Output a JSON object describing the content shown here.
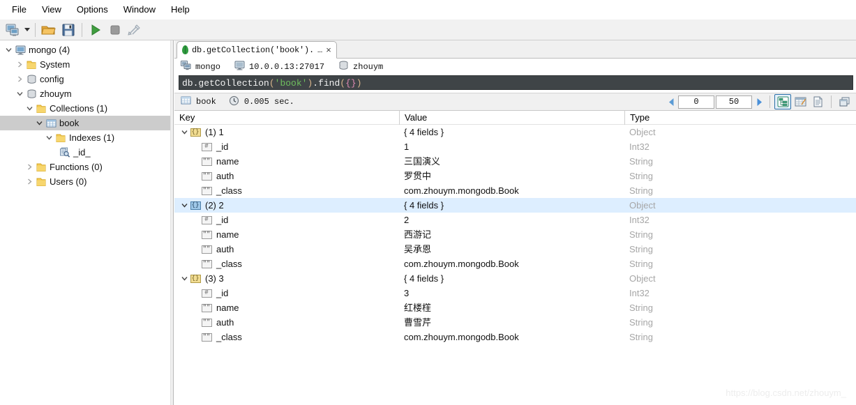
{
  "menubar": {
    "items": [
      {
        "label": "File"
      },
      {
        "label": "View"
      },
      {
        "label": "Options"
      },
      {
        "label": "Window"
      },
      {
        "label": "Help"
      }
    ]
  },
  "toolbar": {
    "connect_label": "connect-icon",
    "dropdown_label": "dropdown-caret",
    "open_label": "open-folder-icon",
    "save_label": "save-icon",
    "run_label": "run-icon",
    "stop_label": "stop-icon",
    "tools_label": "tools-icon"
  },
  "sidebar": {
    "items": [
      {
        "label": "mongo (4)",
        "icon": "server-monitor-icon",
        "indent": 0,
        "twisty": "open",
        "selected": false
      },
      {
        "label": "System",
        "icon": "folder-icon",
        "indent": 1,
        "twisty": "closed",
        "selected": false
      },
      {
        "label": "config",
        "icon": "database-icon",
        "indent": 1,
        "twisty": "closed",
        "selected": false
      },
      {
        "label": "zhouym",
        "icon": "database-icon",
        "indent": 1,
        "twisty": "open",
        "selected": false
      },
      {
        "label": "Collections (1)",
        "icon": "folder-icon",
        "indent": 2,
        "twisty": "open",
        "selected": false
      },
      {
        "label": "book",
        "icon": "collection-grid-icon",
        "indent": 3,
        "twisty": "open",
        "selected": true
      },
      {
        "label": "Indexes (1)",
        "icon": "folder-icon",
        "indent": 4,
        "twisty": "open",
        "selected": false
      },
      {
        "label": "_id_",
        "icon": "index-magnifier-icon",
        "indent": 5,
        "twisty": "none",
        "selected": false
      },
      {
        "label": "Functions (0)",
        "icon": "folder-icon",
        "indent": 2,
        "twisty": "closed",
        "selected": false
      },
      {
        "label": "Users (0)",
        "icon": "folder-icon",
        "indent": 2,
        "twisty": "closed",
        "selected": false
      }
    ]
  },
  "tab": {
    "icon": "mongo-leaf-icon",
    "title": "db.getCollection('book').",
    "ellipsis": "…",
    "close": "×"
  },
  "connection": {
    "server": "mongo",
    "host": "10.0.0.13:27017",
    "database": "zhouym"
  },
  "query": {
    "full_text": "db.getCollection('book').find({})",
    "tokens": [
      {
        "text": "db.getCollection",
        "type": "plain"
      },
      {
        "text": "(",
        "type": "paren"
      },
      {
        "text": "'book'",
        "type": "string"
      },
      {
        "text": ")",
        "type": "paren"
      },
      {
        "text": ".find",
        "type": "plain"
      },
      {
        "text": "(",
        "type": "paren"
      },
      {
        "text": "{}",
        "type": "brace"
      },
      {
        "text": ")",
        "type": "paren"
      }
    ]
  },
  "results_toolbar": {
    "collection": "book",
    "elapsed": "0.005 sec.",
    "skip_value": "0",
    "limit_value": "50",
    "prev_label": "prev-page-arrow",
    "next_label": "next-page-arrow",
    "view_tree_label": "tree-view-icon",
    "view_table_label": "table-view-icon",
    "view_text_label": "text-view-icon",
    "detach_label": "detach-window-icon",
    "active_view": "tree"
  },
  "grid": {
    "headers": {
      "key": "Key",
      "value": "Value",
      "type": "Type"
    },
    "rows": [
      {
        "key": "(1) 1",
        "value": "{ 4 fields }",
        "type": "Object",
        "indent": 0,
        "icon": "object-braces-icon",
        "twisty": "open",
        "selected": false
      },
      {
        "key": "_id",
        "value": "1",
        "type": "Int32",
        "indent": 1,
        "icon": "number-icon",
        "twisty": "none",
        "selected": false
      },
      {
        "key": "name",
        "value": "三国演义",
        "type": "String",
        "indent": 1,
        "icon": "string-icon",
        "twisty": "none",
        "selected": false
      },
      {
        "key": "auth",
        "value": "罗贯中",
        "type": "String",
        "indent": 1,
        "icon": "string-icon",
        "twisty": "none",
        "selected": false
      },
      {
        "key": "_class",
        "value": "com.zhouym.mongodb.Book",
        "type": "String",
        "indent": 1,
        "icon": "string-icon",
        "twisty": "none",
        "selected": false
      },
      {
        "key": "(2) 2",
        "value": "{ 4 fields }",
        "type": "Object",
        "indent": 0,
        "icon": "object-braces-icon",
        "twisty": "open",
        "selected": true
      },
      {
        "key": "_id",
        "value": "2",
        "type": "Int32",
        "indent": 1,
        "icon": "number-icon",
        "twisty": "none",
        "selected": false
      },
      {
        "key": "name",
        "value": "西游记",
        "type": "String",
        "indent": 1,
        "icon": "string-icon",
        "twisty": "none",
        "selected": false
      },
      {
        "key": "auth",
        "value": "吴承恩",
        "type": "String",
        "indent": 1,
        "icon": "string-icon",
        "twisty": "none",
        "selected": false
      },
      {
        "key": "_class",
        "value": "com.zhouym.mongodb.Book",
        "type": "String",
        "indent": 1,
        "icon": "string-icon",
        "twisty": "none",
        "selected": false
      },
      {
        "key": "(3) 3",
        "value": "{ 4 fields }",
        "type": "Object",
        "indent": 0,
        "icon": "object-braces-icon",
        "twisty": "open",
        "selected": false
      },
      {
        "key": "_id",
        "value": "3",
        "type": "Int32",
        "indent": 1,
        "icon": "number-icon",
        "twisty": "none",
        "selected": false
      },
      {
        "key": "name",
        "value": "红楼樦",
        "type": "String",
        "indent": 1,
        "icon": "string-icon",
        "twisty": "none",
        "selected": false
      },
      {
        "key": "auth",
        "value": "曹雪芹",
        "type": "String",
        "indent": 1,
        "icon": "string-icon",
        "twisty": "none",
        "selected": false
      },
      {
        "key": "_class",
        "value": "com.zhouym.mongodb.Book",
        "type": "String",
        "indent": 1,
        "icon": "string-icon",
        "twisty": "none",
        "selected": false
      }
    ]
  },
  "watermark": {
    "text": "https://blog.csdn.net/zhouym_"
  },
  "colors": {
    "selection_blue": "#ddeeff",
    "sidebar_selection": "#cccccc",
    "editor_bg": "#3f4447",
    "accent": "#2a6fa8",
    "type_text": "#a6a6a6"
  }
}
